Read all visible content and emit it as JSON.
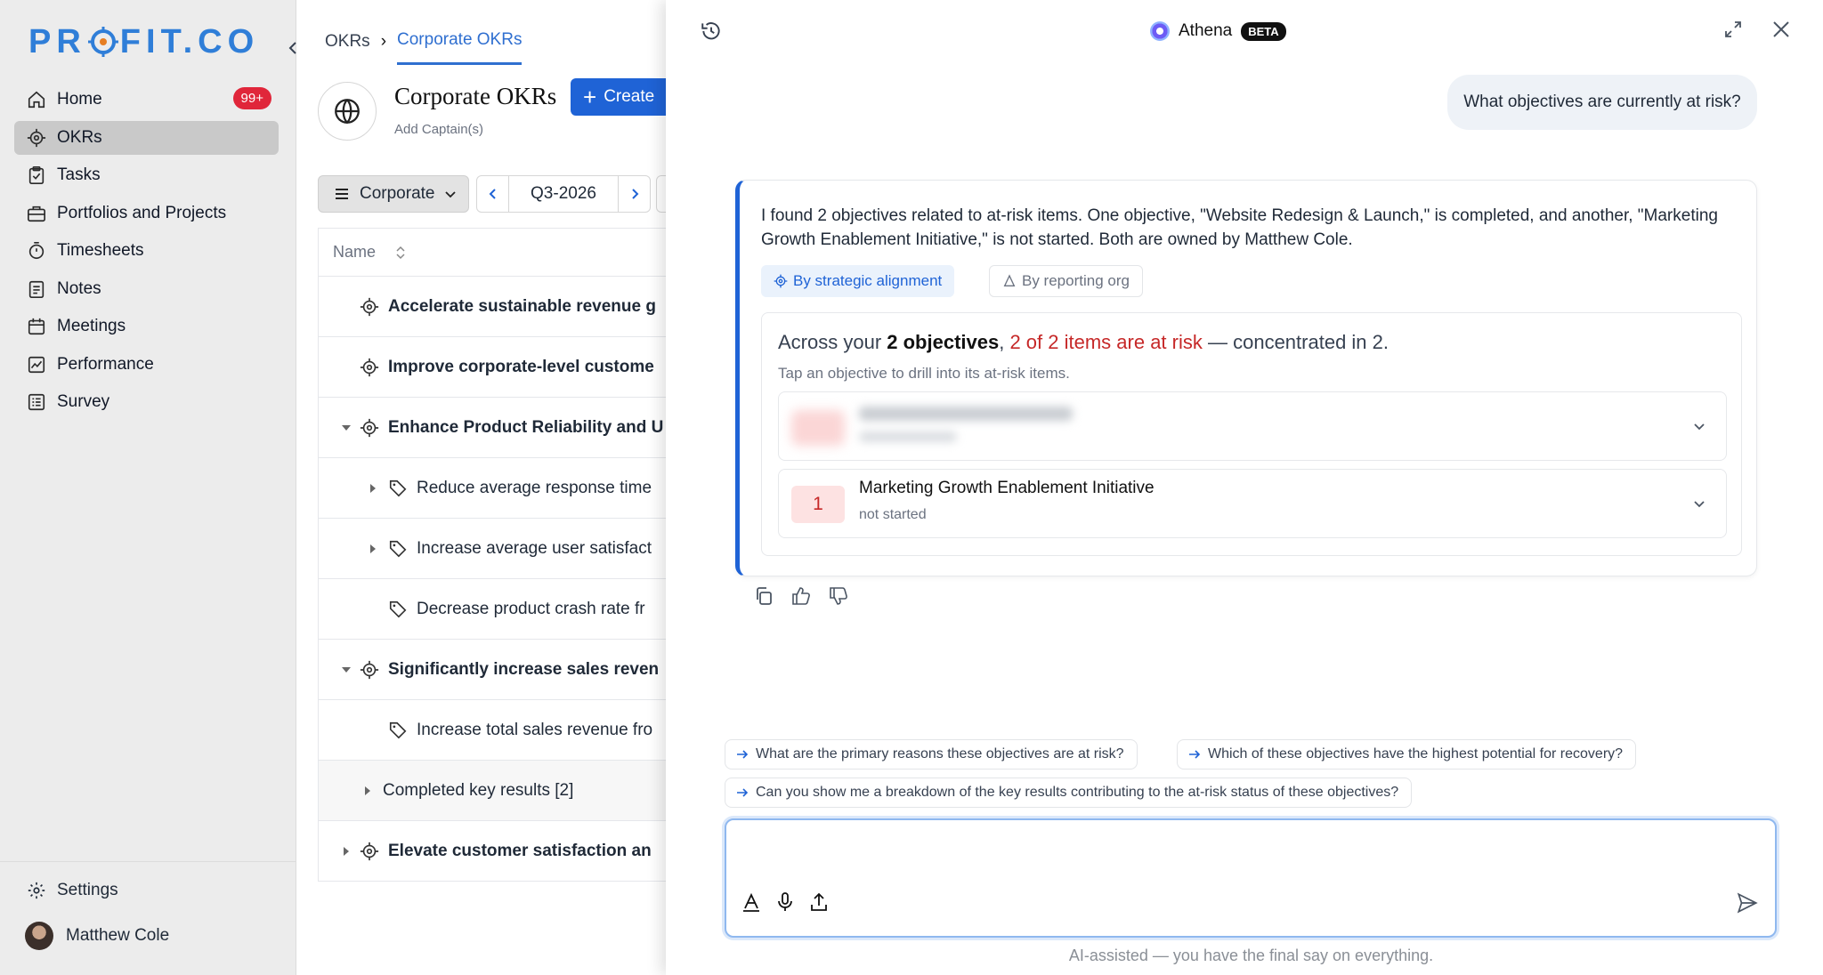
{
  "sidebar": {
    "logo_left": "PR",
    "logo_right": "FIT.CO",
    "items": [
      {
        "label": "Home",
        "badge": "99+"
      },
      {
        "label": "OKRs"
      },
      {
        "label": "Tasks"
      },
      {
        "label": "Portfolios and Projects"
      },
      {
        "label": "Timesheets"
      },
      {
        "label": "Notes"
      },
      {
        "label": "Meetings"
      },
      {
        "label": "Performance"
      },
      {
        "label": "Survey"
      }
    ],
    "settings_label": "Settings",
    "user_name": "Matthew Cole"
  },
  "okr": {
    "breadcrumb": {
      "root": "OKRs",
      "sep": "›",
      "current": "Corporate OKRs"
    },
    "title": "Corporate OKRs",
    "create_label": "Create",
    "add_captain": "Add Captain(s)",
    "filter_label": "Corporate",
    "period": "Q3-2026",
    "name_header": "Name",
    "rows": [
      {
        "label": "Accelerate sustainable revenue g"
      },
      {
        "label": "Improve corporate-level custome"
      },
      {
        "label": "Enhance Product Reliability and U"
      },
      {
        "label": "Reduce average response time"
      },
      {
        "label": "Increase average user satisfact"
      },
      {
        "label": "Decrease product crash rate fr"
      },
      {
        "label": "Significantly increase sales reven"
      },
      {
        "label": "Increase total sales revenue fro"
      },
      {
        "label": "Completed key results [2]"
      },
      {
        "label": "Elevate customer satisfaction an"
      }
    ]
  },
  "athena": {
    "title": "Athena",
    "badge": "BETA",
    "user_question": "What objectives are currently at risk?",
    "answer_text": "I found 2 objectives related to at-risk items. One objective, \"Website Redesign & Launch,\" is completed, and another, \"Marketing Growth Enablement Initiative,\" is not started. Both are owned by Matthew Cole.",
    "tabs": {
      "strategic": "By strategic alignment",
      "reporting": "By reporting org"
    },
    "summary": {
      "prefix": "Across your ",
      "objectives": "2 objectives",
      "comma": ", ",
      "risk": "2 of 2 items are at risk",
      "suffix": " — concentrated in 2."
    },
    "hint": "Tap an objective to drill into its at-risk items.",
    "objective": {
      "count": "1",
      "name": "Marketing Growth Enablement Initiative",
      "status": "not started"
    },
    "suggestions": [
      "What are the primary reasons these objectives are at risk?",
      "Which of these objectives have the highest potential for recovery?",
      "Can you show me a breakdown of the key results contributing to the at-risk status of these objectives?"
    ],
    "disclaimer": "AI-assisted — you have the final say on everything."
  },
  "colors": {
    "accent": "#1f63d6",
    "danger": "#c62828",
    "badge": "#e0263a"
  }
}
